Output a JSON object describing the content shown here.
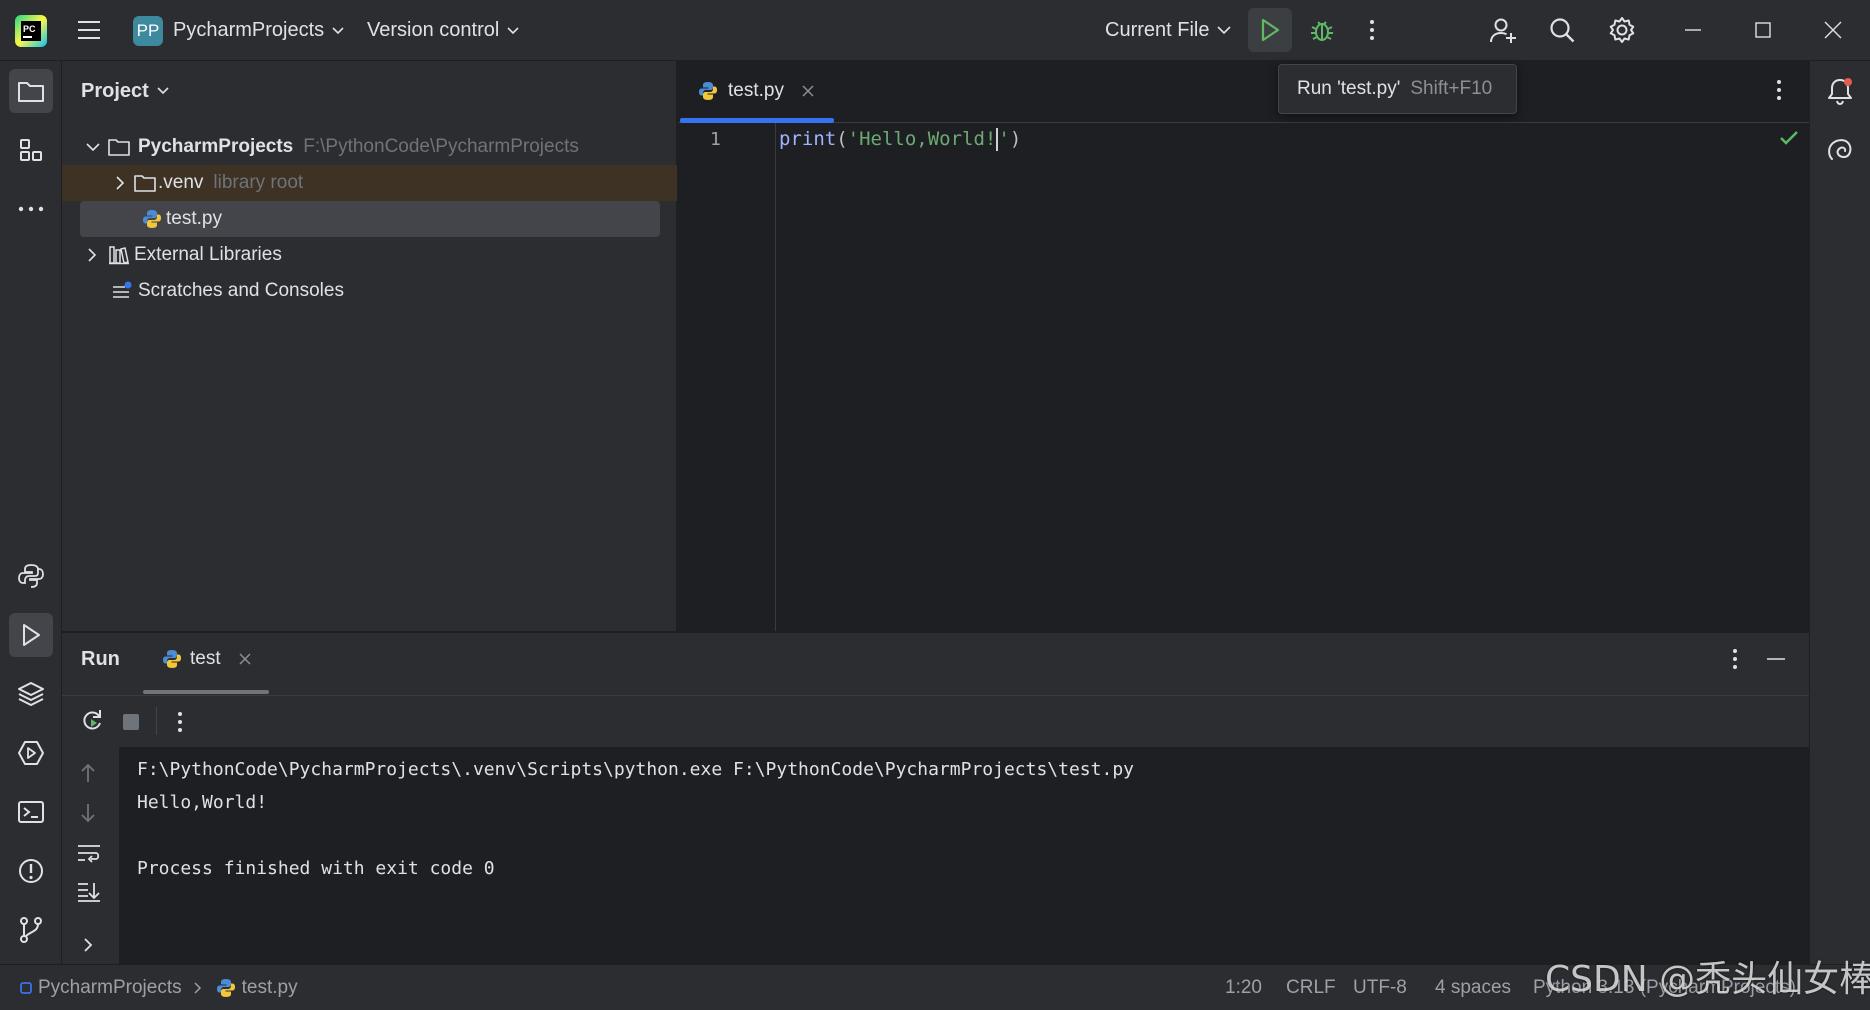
{
  "titlebar": {
    "app_badge": "PP",
    "project_name": "PycharmProjects",
    "vcs_label": "Version control",
    "run_config": "Current File"
  },
  "tooltip": {
    "text": "Run 'test.py'",
    "shortcut": "Shift+F10"
  },
  "project_panel": {
    "title": "Project",
    "tree": {
      "root_name": "PycharmProjects",
      "root_path": "F:\\PythonCode\\PycharmProjects",
      "venv_name": ".venv",
      "venv_hint": "library root",
      "file_name": "test.py",
      "ext_libs": "External Libraries",
      "scratches": "Scratches and Consoles"
    }
  },
  "editor": {
    "tab_label": "test.py",
    "line_number": "1",
    "code": {
      "func": "print",
      "open": "(",
      "str": "'Hello,World!",
      "quote": "'",
      "close": ")"
    }
  },
  "run_panel": {
    "title": "Run",
    "tab_label": "test",
    "console": {
      "line1": "F:\\PythonCode\\PycharmProjects\\.venv\\Scripts\\python.exe F:\\PythonCode\\PycharmProjects\\test.py",
      "line2": "Hello,World!",
      "line3": "Process finished with exit code 0"
    }
  },
  "statusbar": {
    "crumb_project": "PycharmProjects",
    "crumb_file": "test.py",
    "position": "1:20",
    "line_sep": "CRLF",
    "encoding": "UTF-8",
    "indent": "4 spaces",
    "interpreter": "Python 3.13 (PycharmProjects)"
  },
  "watermark": "CSDN @秃头仙女棒",
  "colors": {
    "accent": "#3574f0",
    "run_green": "#5fb865",
    "keyword": "#9fb4ff",
    "string": "#6aab73"
  }
}
